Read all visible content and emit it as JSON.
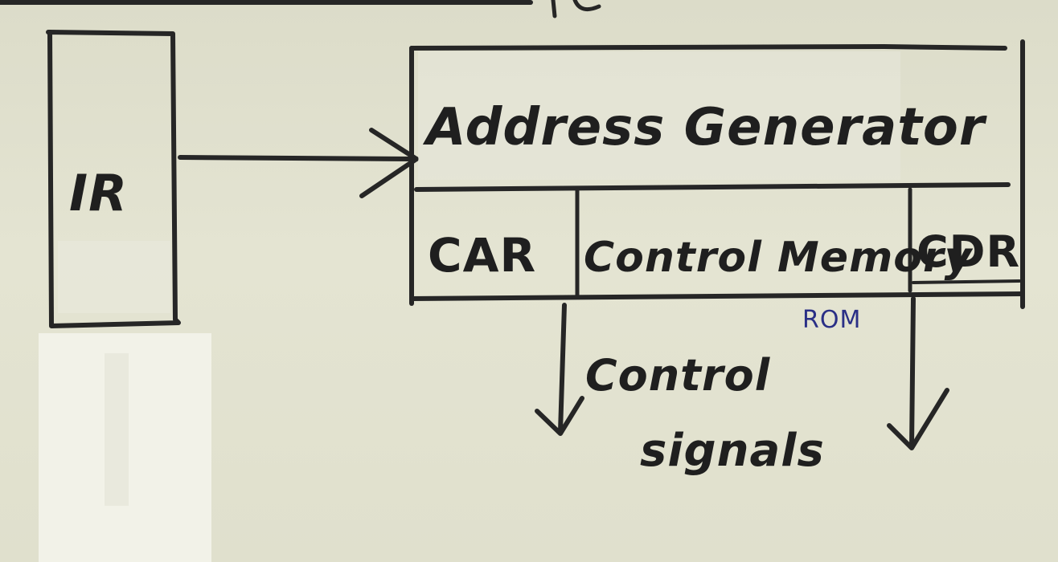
{
  "diagram": {
    "ir_label": "IR",
    "address_generator_label": "Address Generator",
    "car_label": "CAR",
    "control_memory_label": "Control Memory",
    "cdr_label": "CDR",
    "rom_note": "ROM",
    "control_signals_line1": "Control",
    "control_signals_line2": "signals",
    "ink_color": "#262626",
    "note_color": "#2a2f86",
    "paper_color": "#e0e0cd"
  }
}
